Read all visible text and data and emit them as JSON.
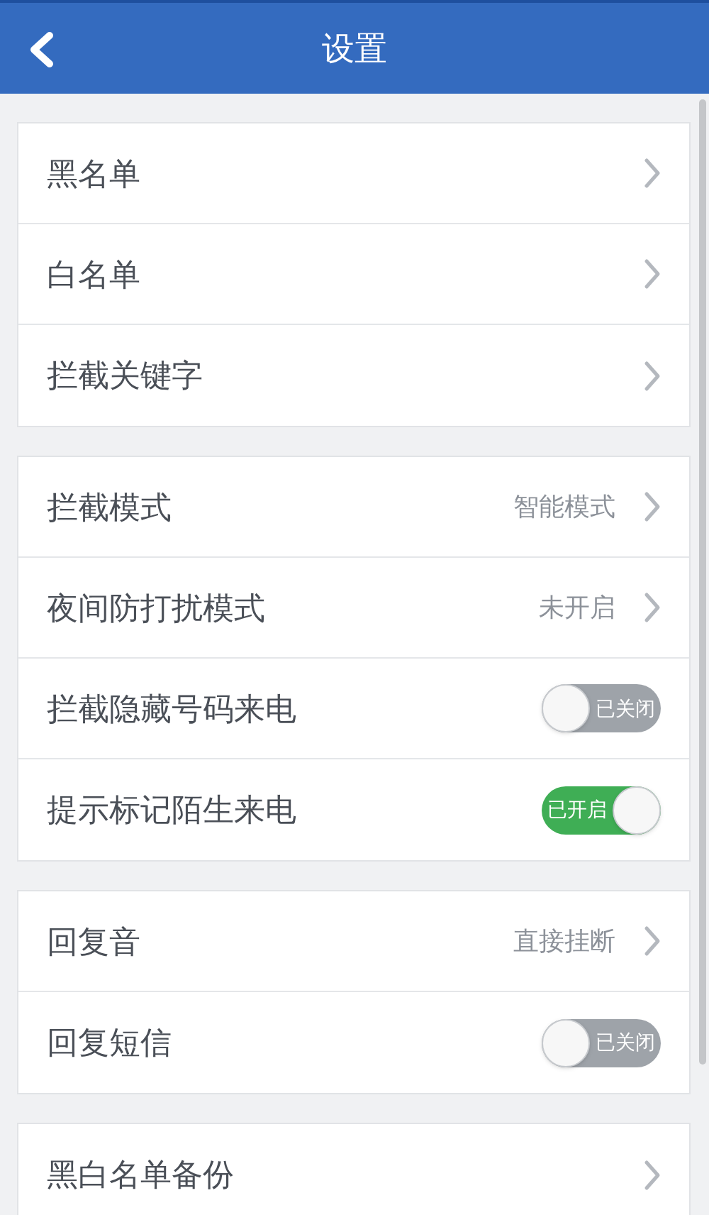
{
  "header": {
    "title": "设置"
  },
  "groups": [
    {
      "rows": [
        {
          "kind": "link",
          "label": "黑名单"
        },
        {
          "kind": "link",
          "label": "白名单"
        },
        {
          "kind": "link",
          "label": "拦截关键字"
        }
      ]
    },
    {
      "rows": [
        {
          "kind": "link",
          "label": "拦截模式",
          "value": "智能模式"
        },
        {
          "kind": "link",
          "label": "夜间防打扰模式",
          "value": "未开启"
        },
        {
          "kind": "toggle",
          "label": "拦截隐藏号码来电",
          "on": false,
          "state_text": "已关闭"
        },
        {
          "kind": "toggle",
          "label": "提示标记陌生来电",
          "on": true,
          "state_text": "已开启"
        }
      ]
    },
    {
      "rows": [
        {
          "kind": "link",
          "label": "回复音",
          "value": "直接挂断"
        },
        {
          "kind": "toggle",
          "label": "回复短信",
          "on": false,
          "state_text": "已关闭"
        }
      ]
    },
    {
      "rows": [
        {
          "kind": "link",
          "label": "黑白名单备份"
        }
      ]
    }
  ]
}
